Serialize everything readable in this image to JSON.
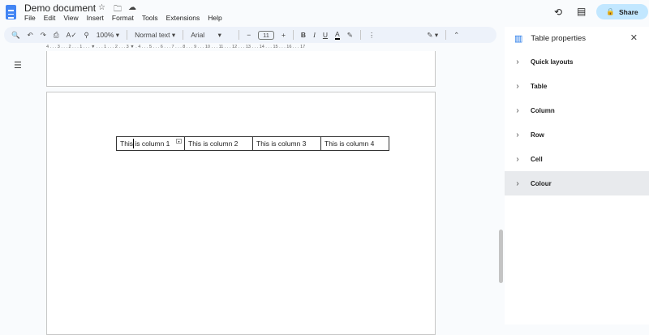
{
  "header": {
    "title": "Demo document",
    "menu": [
      "File",
      "Edit",
      "View",
      "Insert",
      "Format",
      "Tools",
      "Extensions",
      "Help"
    ],
    "share_label": "Share"
  },
  "toolbar": {
    "zoom": "100%",
    "style": "Normal text",
    "font": "Arial",
    "font_size": "11"
  },
  "ruler": "4 . . . 3 . . . 2 . . . 1 . . . ▼ . . . 1 . . . 2 . . . 3 ▼ . 4 . . . 5 . . . 6 . . . 7 . . . 8 . . . 9 . . . 10 . . . 11 . . . 12 . . . 13 . . . 14 . . . 15 . . . 16 . . . 17",
  "table": {
    "cells": [
      "This is column 1",
      "This is column 2",
      "This is column 3",
      "This is column 4"
    ]
  },
  "panel": {
    "title": "Table properties",
    "sections": [
      "Quick layouts",
      "Table",
      "Column",
      "Row",
      "Cell",
      "Colour"
    ],
    "selected": "Colour"
  }
}
